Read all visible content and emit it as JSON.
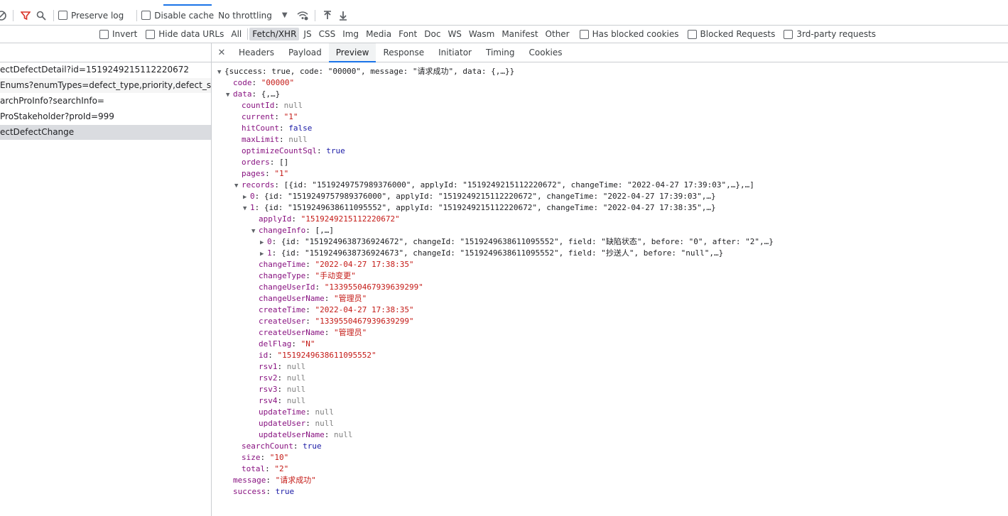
{
  "toolbar": {
    "preserve_log": "Preserve log",
    "disable_cache": "Disable cache",
    "throttling": "No throttling"
  },
  "filter_bar": {
    "invert": "Invert",
    "hide_data_urls": "Hide data URLs",
    "types": [
      "All",
      "Fetch/XHR",
      "JS",
      "CSS",
      "Img",
      "Media",
      "Font",
      "Doc",
      "WS",
      "Wasm",
      "Manifest",
      "Other"
    ],
    "active_type": "Fetch/XHR",
    "blocked_cookies": "Has blocked cookies",
    "blocked_requests": "Blocked Requests",
    "third_party": "3rd-party requests"
  },
  "requests": [
    "ectDefectDetail?id=1519249215112220672",
    "Enums?enumTypes=defect_type,priority,defect_state,...",
    "archProInfo?searchInfo=",
    "ProStakeholder?proId=999",
    "ectDefectChange"
  ],
  "detail_tabs": [
    "Headers",
    "Payload",
    "Preview",
    "Response",
    "Initiator",
    "Timing",
    "Cookies"
  ],
  "active_detail_tab": "Preview",
  "preview": {
    "root": "{success: true, code: \"00000\", message: \"请求成功\", data: {,…}}",
    "code": "\"00000\"",
    "data_summary": "{,…}",
    "countId": "null",
    "current": "\"1\"",
    "hitCount": "false",
    "maxLimit": "null",
    "optimizeCountSql": "true",
    "orders": "[]",
    "pages": "\"1\"",
    "records_summary": "[{id: \"1519249757989376000\", applyId: \"1519249215112220672\", changeTime: \"2022-04-27 17:39:03\",…},…]",
    "record0": "{id: \"1519249757989376000\", applyId: \"1519249215112220672\", changeTime: \"2022-04-27 17:39:03\",…}",
    "record1": "{id: \"1519249638611095552\", applyId: \"1519249215112220672\", changeTime: \"2022-04-27 17:38:35\",…}",
    "applyId": "\"1519249215112220672\"",
    "changeInfo_summary": "[,…]",
    "changeInfo0": "{id: \"1519249638736924672\", changeId: \"1519249638611095552\", field: \"缺陷状态\", before: \"0\", after: \"2\",…}",
    "changeInfo1": "{id: \"1519249638736924673\", changeId: \"1519249638611095552\", field: \"抄送人\", before: \"null\",…}",
    "changeTime": "\"2022-04-27 17:38:35\"",
    "changeType": "\"手动变更\"",
    "changeUserId": "\"1339550467939639299\"",
    "changeUserName": "\"管理员\"",
    "createTime": "\"2022-04-27 17:38:35\"",
    "createUser": "\"1339550467939639299\"",
    "createUserName": "\"管理员\"",
    "delFlag": "\"N\"",
    "id": "\"1519249638611095552\"",
    "rsv1": "null",
    "rsv2": "null",
    "rsv3": "null",
    "rsv4": "null",
    "updateTime": "null",
    "updateUser": "null",
    "updateUserName": "null",
    "searchCount": "true",
    "size": "\"10\"",
    "total": "\"2\"",
    "message": "\"请求成功\"",
    "success": "true"
  }
}
